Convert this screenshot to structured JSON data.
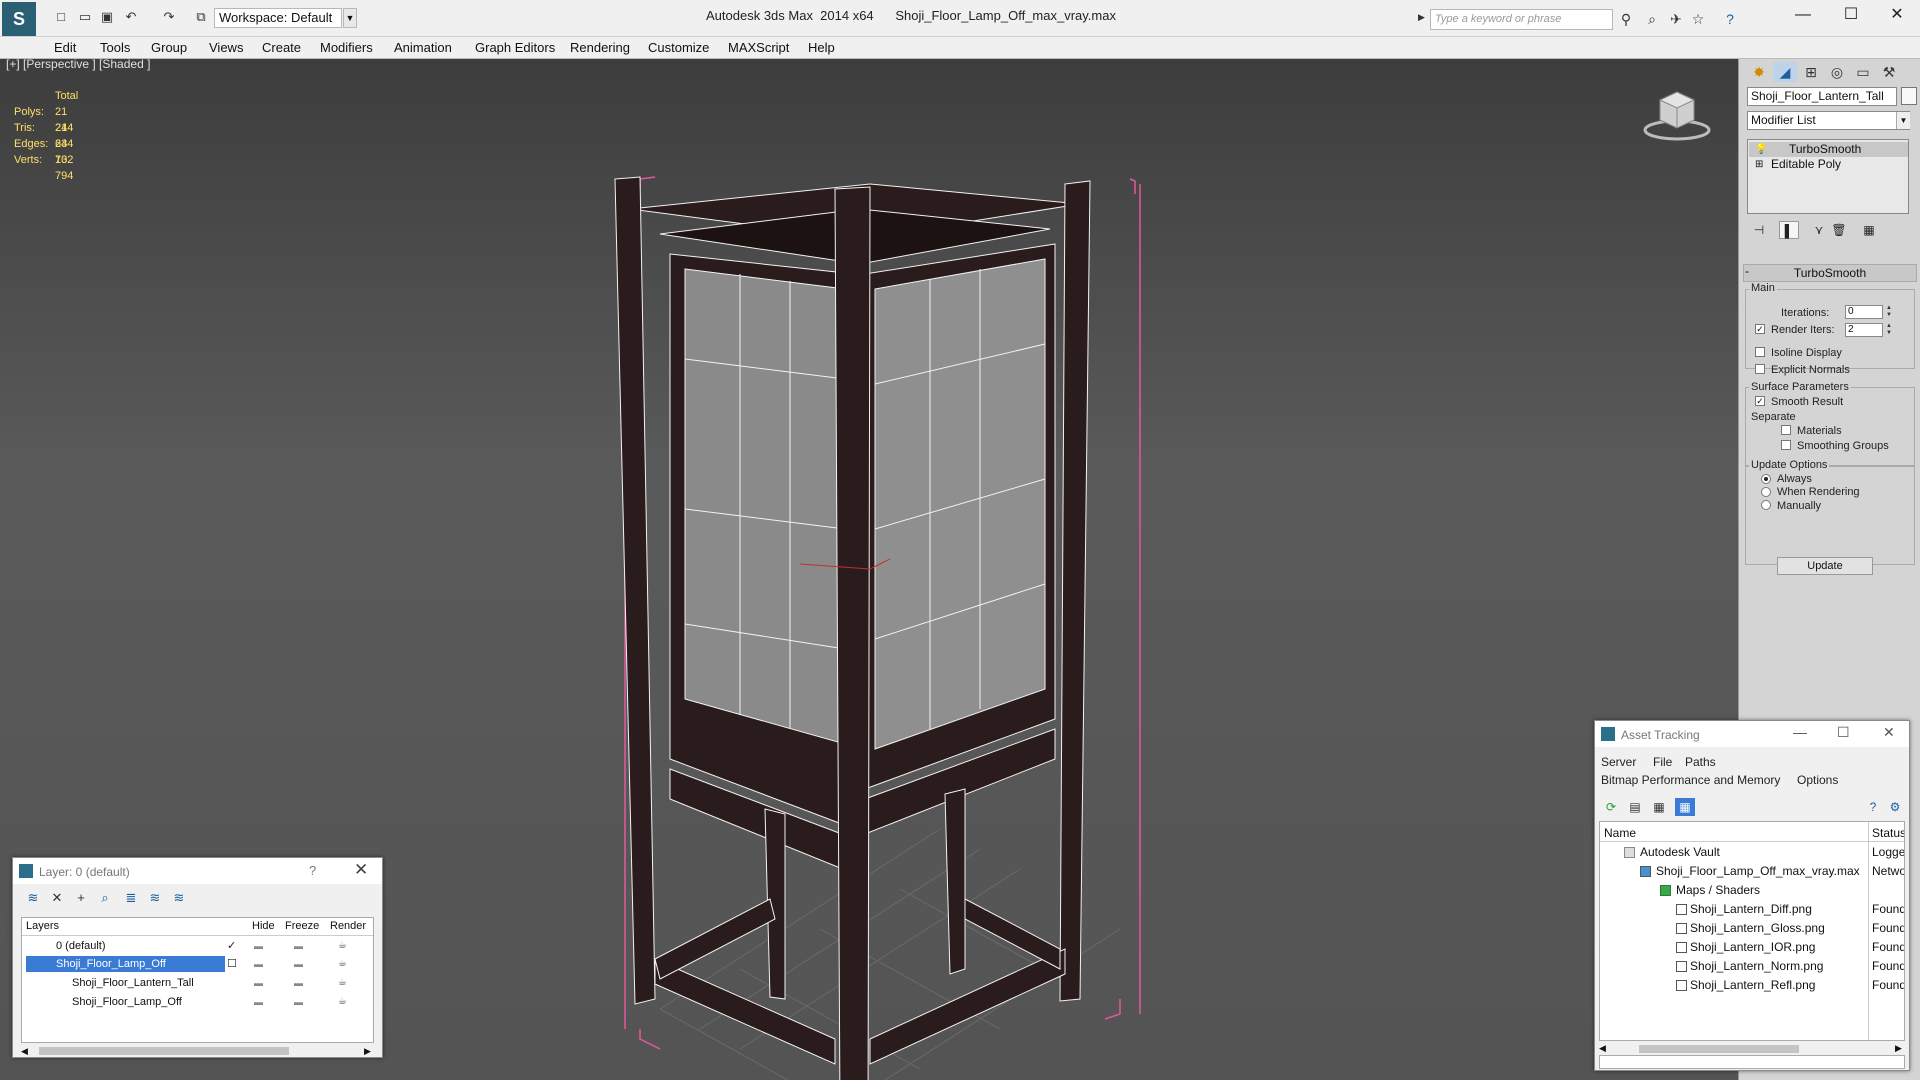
{
  "titlebar": {
    "app_title": "Autodesk 3ds Max  2014 x64",
    "file_name": "Shoji_Floor_Lamp_Off_max_vray.max",
    "workspace_label": "Workspace: Default",
    "search_placeholder": "Type a keyword or phrase"
  },
  "menubar": {
    "items": [
      "Edit",
      "Tools",
      "Group",
      "Views",
      "Create",
      "Modifiers",
      "Animation",
      "Graph Editors",
      "Rendering",
      "Customize",
      "MAXScript",
      "Help"
    ]
  },
  "viewport": {
    "label": "[+] [Perspective ] [Shaded ]",
    "stats": {
      "header": "Total",
      "rows": [
        {
          "key": "Polys:",
          "value": "21 244"
        },
        {
          "key": "Tris:",
          "value": "21 244"
        },
        {
          "key": "Edges:",
          "value": "63 732"
        },
        {
          "key": "Verts:",
          "value": "10 794"
        }
      ]
    }
  },
  "command_panel": {
    "object_name": "Shoji_Floor_Lantern_Tall",
    "modifier_list": "Modifier List",
    "stack": [
      "TurboSmooth",
      "Editable Poly"
    ],
    "rollout_title": "TurboSmooth",
    "main_group": "Main",
    "iterations_label": "Iterations:",
    "iterations_value": "0",
    "render_iters_label": "Render Iters:",
    "render_iters_value": "2",
    "isoline_label": "Isoline Display",
    "explicit_normals_label": "Explicit Normals",
    "surface_params_group": "Surface Parameters",
    "smooth_result_label": "Smooth Result",
    "separate_label": "Separate",
    "materials_label": "Materials",
    "smoothing_groups_label": "Smoothing Groups",
    "update_options_group": "Update Options",
    "always_label": "Always",
    "when_rendering_label": "When Rendering",
    "manually_label": "Manually",
    "update_button": "Update"
  },
  "layer_dialog": {
    "title": "Layer: 0 (default)",
    "help": "?",
    "columns": [
      "Layers",
      "Hide",
      "Freeze",
      "Render"
    ],
    "rows": [
      {
        "name": "0 (default)"
      },
      {
        "name": "Shoji_Floor_Lamp_Off"
      },
      {
        "name": "Shoji_Floor_Lantern_Tall"
      },
      {
        "name": "Shoji_Floor_Lamp_Off"
      }
    ]
  },
  "asset_tracking": {
    "title": "Asset Tracking",
    "menu_row1": [
      "Server",
      "File",
      "Paths"
    ],
    "menu_row2": [
      "Bitmap Performance and Memory",
      "Options"
    ],
    "columns": [
      "Name",
      "Status"
    ],
    "rows": [
      {
        "name": "Autodesk Vault",
        "status": "Logged"
      },
      {
        "name": "Shoji_Floor_Lamp_Off_max_vray.max",
        "status": "Netwo"
      },
      {
        "name": "Maps / Shaders",
        "status": ""
      },
      {
        "name": "Shoji_Lantern_Diff.png",
        "status": "Found"
      },
      {
        "name": "Shoji_Lantern_Gloss.png",
        "status": "Found"
      },
      {
        "name": "Shoji_Lantern_IOR.png",
        "status": "Found"
      },
      {
        "name": "Shoji_Lantern_Norm.png",
        "status": "Found"
      },
      {
        "name": "Shoji_Lantern_Refl.png",
        "status": "Found"
      }
    ]
  },
  "colors": {
    "selection": "#3a7bd5",
    "stats_text": "#ffe066",
    "bbox": "#e05a9a"
  }
}
